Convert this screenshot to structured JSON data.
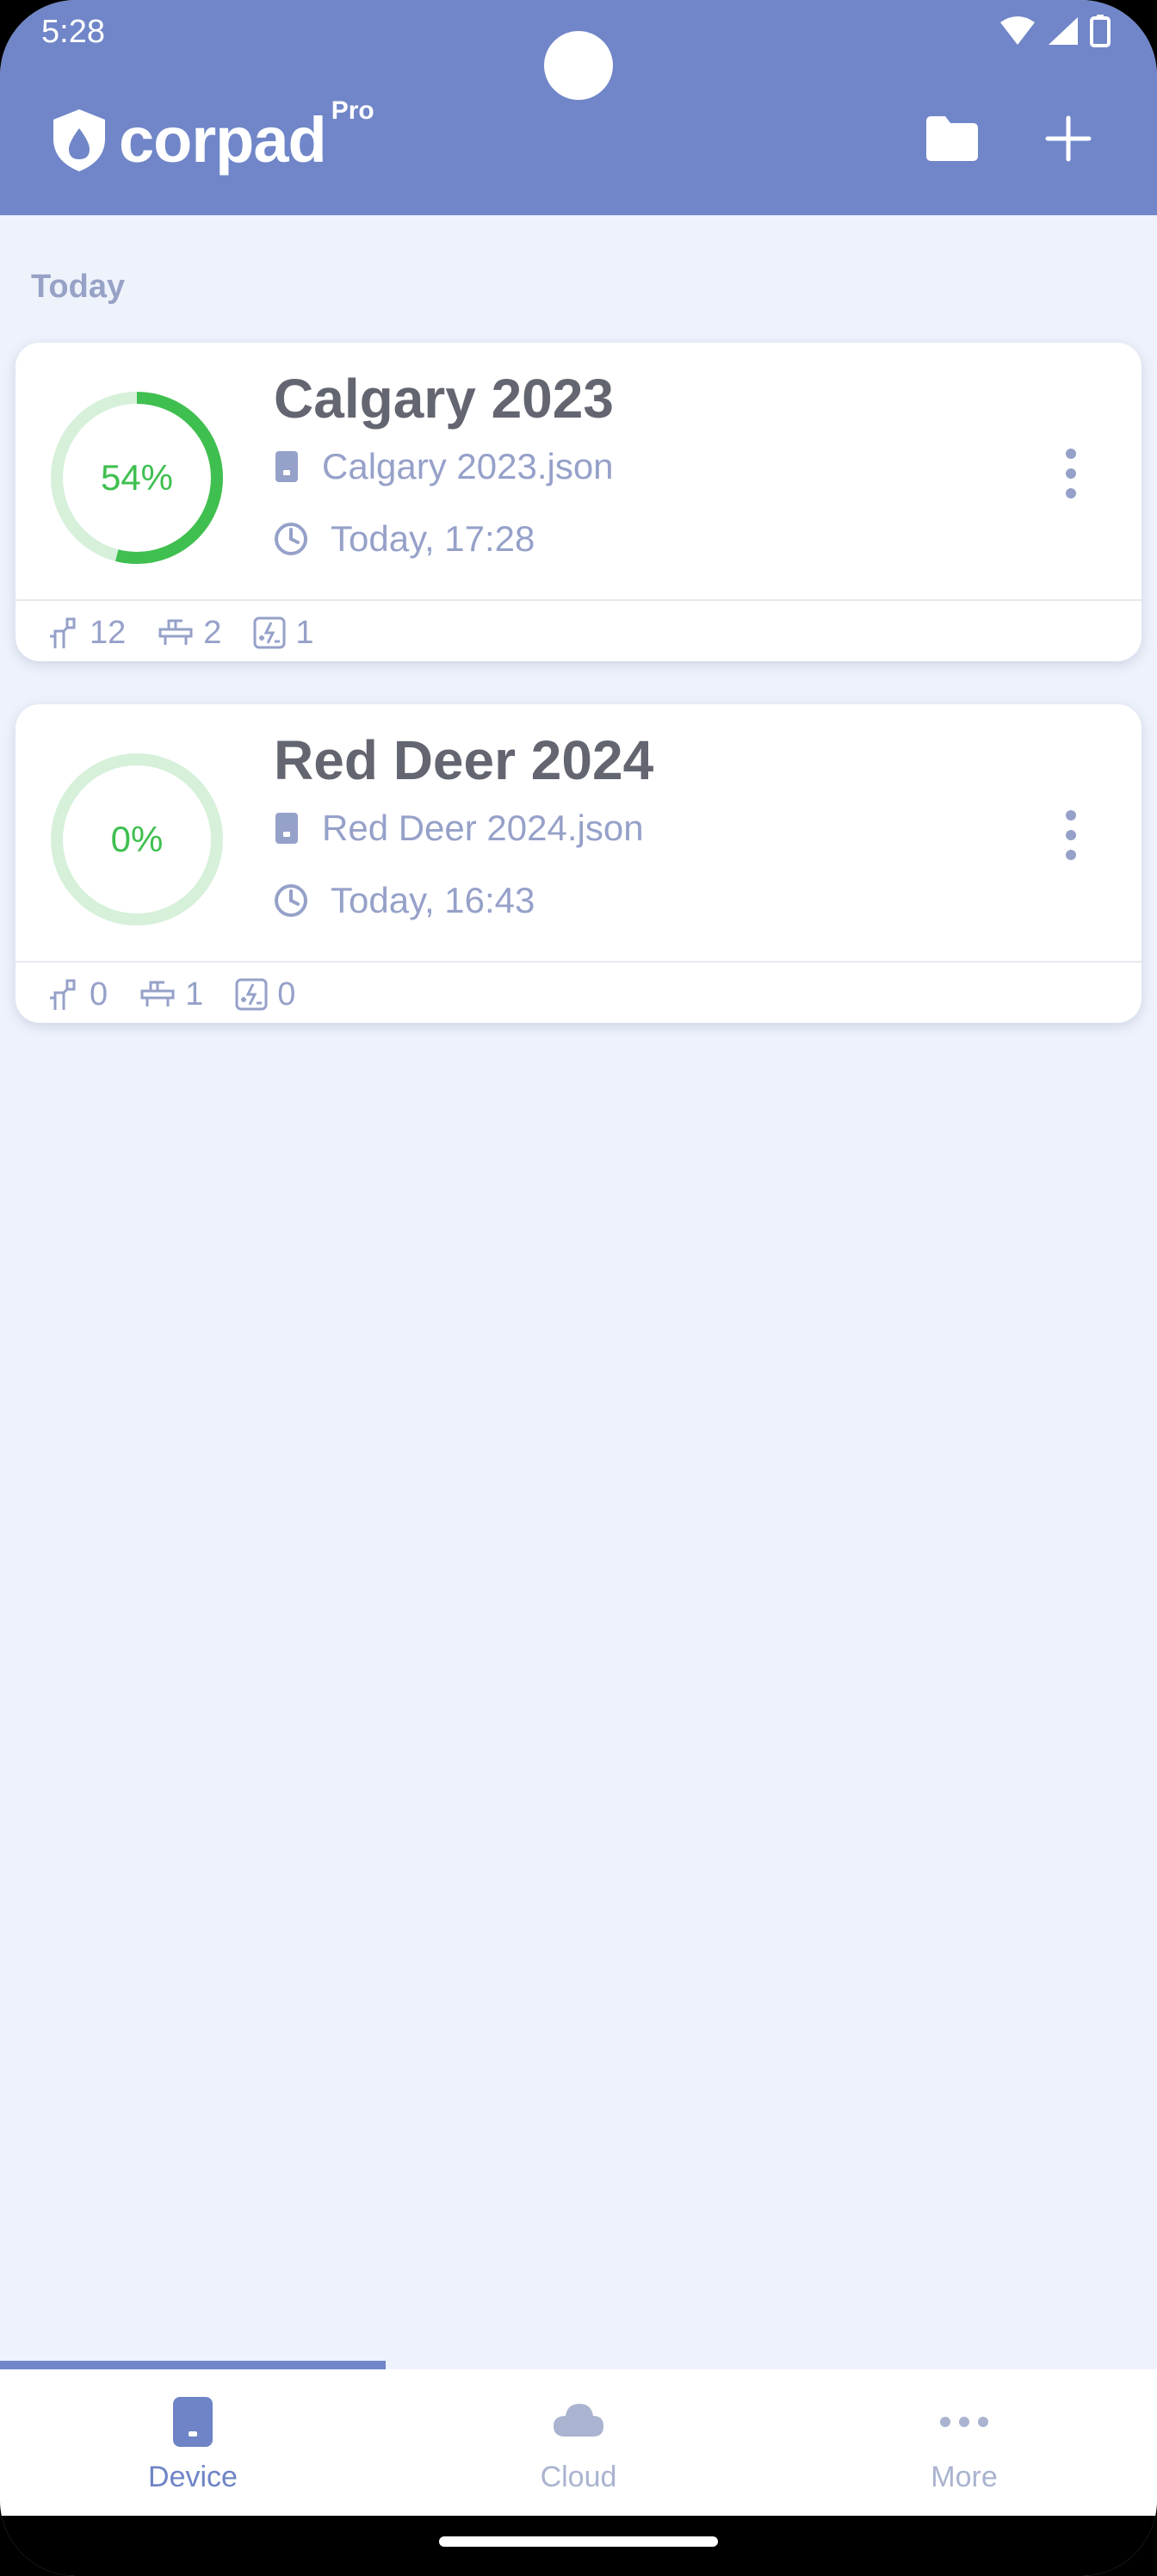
{
  "status_bar": {
    "time": "5:28"
  },
  "header": {
    "app_name": "corpad",
    "badge": "Pro",
    "brand_color": "#7086c8",
    "icons": [
      "shield-drop-icon",
      "folder-icon",
      "plus-icon"
    ]
  },
  "section": {
    "label": "Today"
  },
  "projects": [
    {
      "title": "Calgary 2023",
      "progress": 0.54,
      "progress_label": "54%",
      "file": "Calgary 2023.json",
      "time": "Today, 17:28",
      "stats": {
        "test_points": "12",
        "rectifiers": "2",
        "bonds": "1"
      }
    },
    {
      "title": "Red Deer 2024",
      "progress": 0,
      "progress_label": "0%",
      "file": "Red Deer 2024.json",
      "time": "Today, 16:43",
      "stats": {
        "test_points": "0",
        "rectifiers": "1",
        "bonds": "0"
      }
    }
  ],
  "colors": {
    "progress": "#3fbf4f",
    "progress_track": "#d6f0da",
    "muted": "#96a1c9"
  },
  "bottom_nav": {
    "items": [
      {
        "label": "Device",
        "icon": "device-icon",
        "active": true
      },
      {
        "label": "Cloud",
        "icon": "cloud-icon",
        "active": false
      },
      {
        "label": "More",
        "icon": "more-horizontal-icon",
        "active": false
      }
    ]
  }
}
